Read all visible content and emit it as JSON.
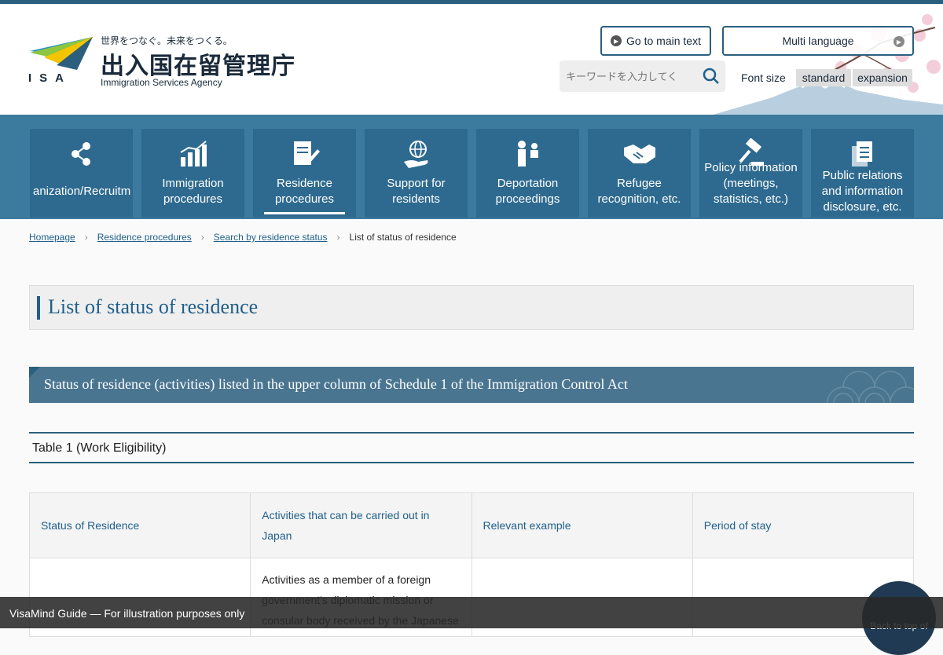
{
  "header": {
    "logo_abbr": "ISA",
    "tagline": "世界をつなぐ。未来をつくる。",
    "org_name_jp": "出入国在留管理庁",
    "org_name_en": "Immigration Services Agency",
    "go_main_label": "Go to main text",
    "multi_language_label": "Multi language",
    "search_placeholder": "キーワードを入力してく",
    "font_size_label": "Font size",
    "font_standard": "standard",
    "font_expansion": "expansion"
  },
  "nav": {
    "items": [
      {
        "label": "anization/Recruitm",
        "icon": "people-network-icon"
      },
      {
        "label": "Immigration procedures",
        "icon": "bar-chart-icon"
      },
      {
        "label": "Residence procedures",
        "icon": "document-pen-icon",
        "active": true
      },
      {
        "label": "Support for residents",
        "icon": "globe-hand-icon"
      },
      {
        "label": "Deportation proceedings",
        "icon": "person-escort-icon"
      },
      {
        "label": "Refugee recognition, etc.",
        "icon": "handshake-icon"
      },
      {
        "label": "Policy information (meetings, statistics, etc.)",
        "icon": "gavel-icon"
      },
      {
        "label": "Public relations and information disclosure, etc.",
        "icon": "documents-icon"
      }
    ]
  },
  "breadcrumb": {
    "items": [
      "Homepage",
      "Residence procedures",
      "Search by residence status"
    ],
    "current": "List of status of residence"
  },
  "page_title": "List of status of residence",
  "section_heading": "Status of residence (activities) listed in the upper column of Schedule 1 of the Immigration Control Act",
  "table": {
    "caption": "Table 1 (Work Eligibility)",
    "headers": [
      "Status of Residence",
      "Activities that can be carried out in Japan",
      "Relevant example",
      "Period of stay"
    ],
    "rows": [
      [
        "",
        "Activities as a member of a foreign government's diplomatic mission or consular body received by the Japanese",
        "",
        ""
      ]
    ]
  },
  "footer": {
    "notice": "VisaMind Guide — For illustration purposes only",
    "back_to_top": "Back to top of"
  },
  "colors": {
    "primary": "#1f5f8b",
    "nav_bg": "#3c7a9e",
    "nav_item_bg": "#2e6a8f",
    "section_bg": "#4a7590"
  }
}
